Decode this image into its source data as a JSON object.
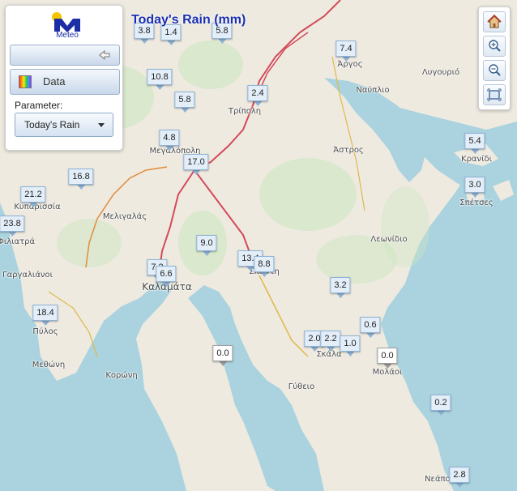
{
  "title": "Today's Rain (mm)",
  "logo": {
    "text": "Meteo"
  },
  "panel": {
    "data_label": "Data",
    "parameter_label": "Parameter:",
    "parameter_value": "Today's Rain"
  },
  "colors": {
    "title": "#1a2fb0",
    "sea": "#aad3df",
    "marker_fill": "#e3eef8",
    "road": "#d44a5a"
  },
  "icons": [
    "home-icon",
    "zoom-in-icon",
    "zoom-out-icon",
    "full-extent-icon",
    "collapse-arrow-icon",
    "palette-icon"
  ],
  "places": [
    {
      "name": "Άργος"
    },
    {
      "name": "Λυγουριό"
    },
    {
      "name": "Ναύπλιο"
    },
    {
      "name": "Τρίπολη"
    },
    {
      "name": "Άστρος"
    },
    {
      "name": "Μεγαλόπολη"
    },
    {
      "name": "Κρανίδι"
    },
    {
      "name": "Σπέτσες"
    },
    {
      "name": "Κυπαρισσία"
    },
    {
      "name": "Μελιγαλάς"
    },
    {
      "name": "Φιλιατρά"
    },
    {
      "name": "Λεωνίδιο"
    },
    {
      "name": "Γαργαλιάνοι"
    },
    {
      "name": "Καλαμάτα"
    },
    {
      "name": "Σπάρτη"
    },
    {
      "name": "Πύλος"
    },
    {
      "name": "Μεθώνη"
    },
    {
      "name": "Κορώνη"
    },
    {
      "name": "Σκάλα"
    },
    {
      "name": "Μολάοι"
    },
    {
      "name": "Γύθειο"
    },
    {
      "name": "Νεάπολη"
    }
  ],
  "stations": [
    {
      "value": "3.8"
    },
    {
      "value": "1.4"
    },
    {
      "value": "5.8"
    },
    {
      "value": "7.4"
    },
    {
      "value": "10.8"
    },
    {
      "value": "5.8"
    },
    {
      "value": "2.4"
    },
    {
      "value": "4.8"
    },
    {
      "value": "17.0"
    },
    {
      "value": "5.4"
    },
    {
      "value": "16.8"
    },
    {
      "value": "3.0"
    },
    {
      "value": "21.2"
    },
    {
      "value": "23.8"
    },
    {
      "value": "9.0"
    },
    {
      "value": "13.4"
    },
    {
      "value": "8.8"
    },
    {
      "value": "7.2"
    },
    {
      "value": "6.6"
    },
    {
      "value": "3.2"
    },
    {
      "value": "18.4"
    },
    {
      "value": "0.6"
    },
    {
      "value": "2.0"
    },
    {
      "value": "2.2"
    },
    {
      "value": "1.0"
    },
    {
      "value": "0.0"
    },
    {
      "value": "0.0"
    },
    {
      "value": "0.2"
    },
    {
      "value": "2.8"
    }
  ]
}
